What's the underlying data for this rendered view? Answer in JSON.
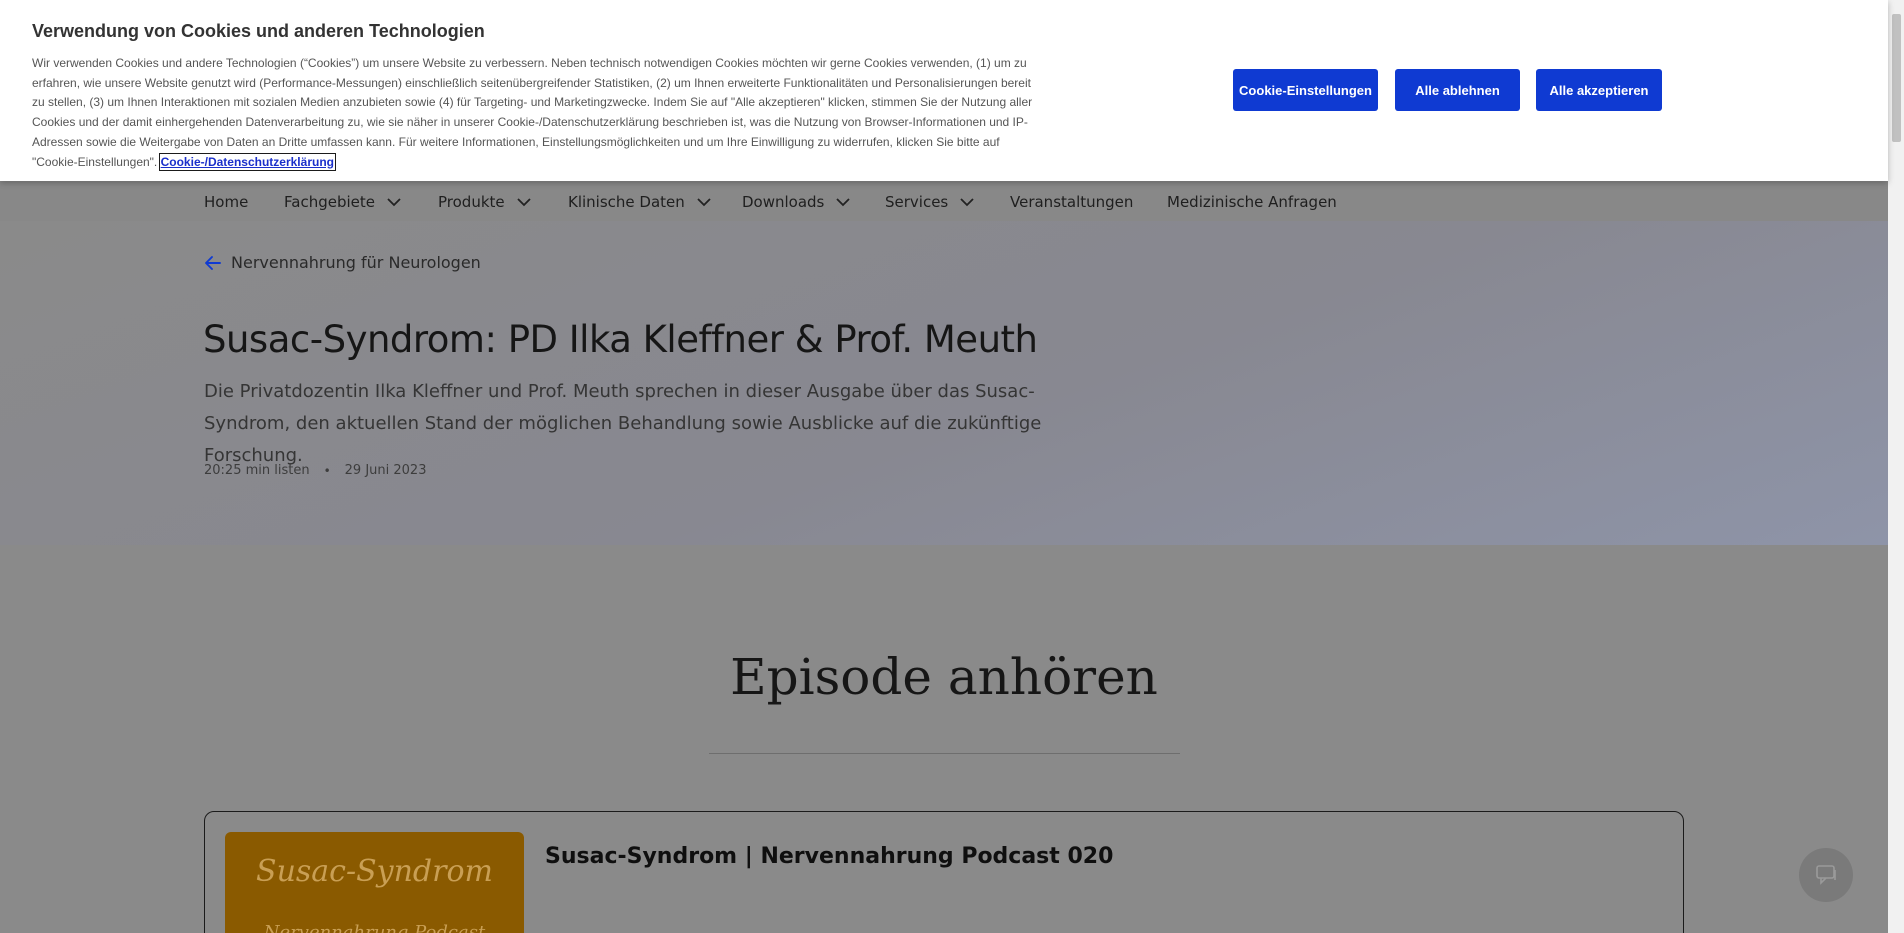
{
  "cookie_banner": {
    "title": "Verwendung von Cookies und anderen Technologien",
    "text": "Wir verwenden Cookies und andere Technologien (“Cookies”) um unsere Website zu verbessern. Neben technisch notwendigen Cookies möchten wir gerne Cookies verwenden, (1) um zu erfahren, wie unsere Website genutzt wird (Performance-Messungen) einschließlich seitenübergreifender Statistiken, (2) um Ihnen erweiterte Funktionalitäten und Personalisierungen bereit zu stellen, (3) um Ihnen Interaktionen mit sozialen Medien anzubieten sowie (4) für Targeting- und Marketingzwecke. Indem Sie auf \"Alle akzeptieren\" klicken, stimmen Sie der Nutzung aller Cookies und der damit einhergehenden Datenverarbeitung zu, wie sie näher in unserer Cookie-/Datenschutzerklärung beschrieben ist, was die Nutzung von Browser-Informationen und IP-Adressen sowie die Weitergabe von Daten an Dritte umfassen kann. Für weitere Informationen, Einstellungsmöglichkeiten und um Ihre Einwilligung zu widerrufen, klicken Sie bitte auf \"Cookie-Einstellungen\".",
    "link_label": "Cookie-/Datenschutzerklärung",
    "settings_button": "Cookie-Einstellungen",
    "reject_button": "Alle ablehnen",
    "accept_button": "Alle akzeptieren",
    "button_color": "#0f3ad2"
  },
  "nav": {
    "items": [
      {
        "label": "Home",
        "has_dropdown": false
      },
      {
        "label": "Fachgebiete",
        "has_dropdown": true
      },
      {
        "label": "Produkte",
        "has_dropdown": true
      },
      {
        "label": "Klinische Daten",
        "has_dropdown": true
      },
      {
        "label": "Downloads",
        "has_dropdown": true
      },
      {
        "label": "Services",
        "has_dropdown": true
      },
      {
        "label": "Veranstaltungen",
        "has_dropdown": false
      },
      {
        "label": "Medizinische Anfragen",
        "has_dropdown": false
      }
    ]
  },
  "hero": {
    "back_link": "Nervennahrung für Neurologen",
    "title": "Susac-Syndrom: PD Ilka Kleffner & Prof. Meuth",
    "description": "Die Privatdozentin Ilka Kleffner und Prof. Meuth sprechen in dieser Ausgabe über das Susac-Syndrom, den aktuellen Stand der möglichen Behandlung sowie Ausblicke auf die zukünftige Forschung.",
    "duration": "20:25 min listen",
    "separator": "•",
    "date": "29 Juni 2023"
  },
  "episode_section": {
    "heading": "Episode anhören",
    "card": {
      "cover_title": "Susac-Syndrom",
      "cover_subtitle": "Nervennahrung Podcast",
      "title": "Susac-Syndrom | Nervennahrung Podcast 020"
    }
  },
  "icons": {
    "back": "arrow-left-icon",
    "dropdown": "chevron-down-icon",
    "chat": "chat-icon"
  }
}
